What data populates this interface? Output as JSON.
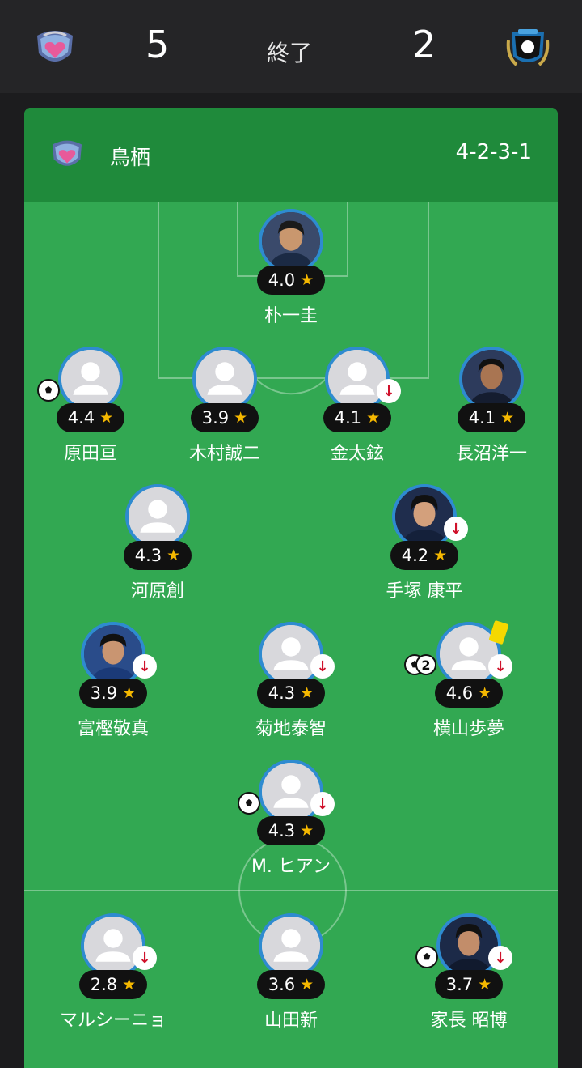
{
  "match": {
    "home_score": "5",
    "away_score": "2",
    "status": "終了"
  },
  "lineup": {
    "team_name": "鳥栖",
    "formation": "4-2-3-1"
  },
  "players": [
    {
      "name": "朴一圭",
      "rating": "4.0"
    },
    {
      "name": "原田亘",
      "rating": "4.4"
    },
    {
      "name": "木村誠二",
      "rating": "3.9"
    },
    {
      "name": "金太鉉",
      "rating": "4.1"
    },
    {
      "name": "長沼洋一",
      "rating": "4.1"
    },
    {
      "name": "河原創",
      "rating": "4.3"
    },
    {
      "name": "手塚 康平",
      "rating": "4.2"
    },
    {
      "name": "富樫敬真",
      "rating": "3.9"
    },
    {
      "name": "菊地泰智",
      "rating": "4.3"
    },
    {
      "name": "横山歩夢",
      "rating": "4.6",
      "goals": "2"
    },
    {
      "name": "M. ヒアン",
      "rating": "4.3"
    },
    {
      "name": "マルシーニョ",
      "rating": "2.8"
    },
    {
      "name": "山田新",
      "rating": "3.6"
    },
    {
      "name": "家長 昭博",
      "rating": "3.7"
    }
  ],
  "icons": {
    "star": "★",
    "sub_out": "↓"
  },
  "colors": {
    "pitch": "#32a852",
    "header": "#1f8a3b",
    "star": "#f5b800",
    "sub_out": "#d0112b",
    "avatar_ring": "#2e8bd0"
  }
}
